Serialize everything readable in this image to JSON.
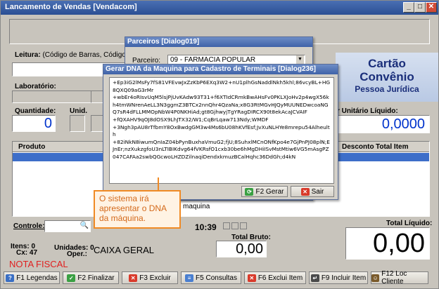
{
  "window": {
    "title": "Lancamento de Vendas [Vendacom]"
  },
  "labels": {
    "leitura": "Leitura:",
    "leitura_hint": "(Código de Barras, Código Redu",
    "laboratorio": "Laboratório:",
    "quantidade": "Quantidade:",
    "unid": "Unid.",
    "unitario_liquido": "r Unitário Líquido:",
    "produto": "Produto",
    "desconto": "Desconto",
    "total_item": "Total Item",
    "controle": "Controle:",
    "time": "10:39",
    "total_bruto": "Total Bruto:",
    "total_liquido": "Total Líquido:",
    "itens": "Itens: 0",
    "cx": "Cx: 47",
    "unidades": "Unidades: 0",
    "oper": "Oper.:",
    "oper_value": "CAIXA GERAL",
    "nota_fiscal": "NOTA FISCAL",
    "maquina": "maquina"
  },
  "values": {
    "quantidade": "0",
    "unitario_liquido": "0,0000",
    "total_bruto": "0,00",
    "total_liquido": "0,00"
  },
  "card": {
    "line1": "Cartão",
    "line2": "Convênio",
    "line3": "Pessoa Jurídica"
  },
  "parceiros_dialog": {
    "title": "Parceiros [Dialog019]",
    "label": "Parceiro:",
    "selected": "09 - FARMACIA POPULAR"
  },
  "dna_dialog": {
    "title": "Gerar DNA da Maquina para Cadastro de Terminais [Dialog236]",
    "text": "+Ep3iG2lMsFy7fS81VFEvwJxZzKbP6EXq3W2+nU1plhGsNaddlNkh5khl;86vcyBL+HG8QXQ09aG3rMr\n+wbEr4oRIsvUqM5lsjPjUvKAdw93T31+f6XTIdCRmkBwAHsFv0PKLXJoHv2p4wgX56kh4tmWNrenAeLL3N3ggmZ3BTCx2nnQhr4QzaNa;x8G3RtMGvHJQyMUUNEDwcoaNGQ7sR4dFLLMMOpNbW4P0NKHiAd;gt8GjhwyjTgYRagDIRCX90t8ekAcaJCVAIF\n+fQXAHV9qOJ8dOSX9LhJTX32/W1;CqBrLqaw713Ndy;WMDF\n+3Ngh3pAU8rTfbmY8OxBwdgGM3w4Ms6bU08hKVfEsf;JvXuNLHYe8mrepu54Alheulth\n+82iNkN8iwumQnIaZ04bPynBuxhaVmuG2;fjU;8SuhxlMCnONfKpo4e7GjPnPJ08plN;EJnEr;nzXukzgfoU3nLTIBIKdvg64fVKRsfO1cxb30be6hMgDHiISvMstMtiw6VG5mAsgPZ047CAFAa2swbQGcwoLHZDZilnaqiDendxkmuzBCalHqhc36DdGh;d4kN",
    "generate_label": "F2 Gerar",
    "exit_label": "Sair"
  },
  "callout": {
    "text": "O sistema irá apresentar o DNA da máquina."
  },
  "function_keys": [
    {
      "label": "F1 Legendas",
      "icon": "help-icon",
      "color": "#3a6fc4"
    },
    {
      "label": "F2 Finalizar",
      "icon": "check-icon",
      "color": "#3aa043"
    },
    {
      "label": "F3 Excluir",
      "icon": "delete-icon",
      "color": "#d93a2b"
    },
    {
      "label": "F5 Consultas",
      "icon": "document-icon",
      "color": "#4a7fd0"
    },
    {
      "label": "F6 Exclui Item",
      "icon": "delete-icon",
      "color": "#d93a2b"
    },
    {
      "label": "F9 Incluir Item",
      "icon": "insert-icon",
      "color": "#4a4a4a"
    },
    {
      "label": "F12 Loc Cliente",
      "icon": "client-icon",
      "color": "#7a5a2a"
    }
  ]
}
